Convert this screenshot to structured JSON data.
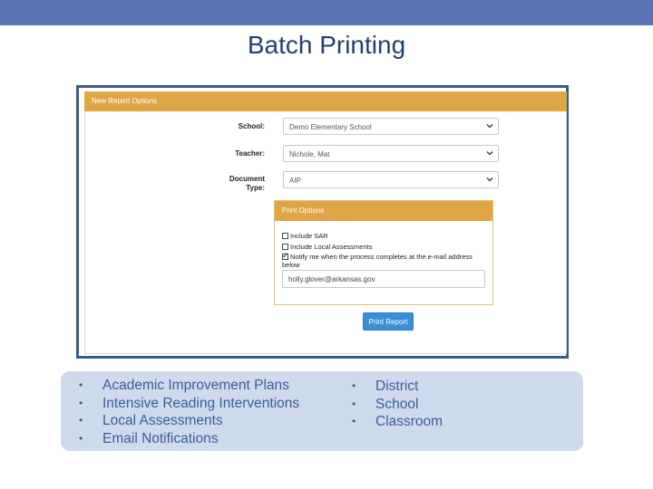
{
  "slide": {
    "title": "Batch Printing"
  },
  "panel": {
    "header": "New Report Options",
    "school_label": "School:",
    "school_value": "Demo Elementary School",
    "teacher_label": "Teacher:",
    "teacher_value": "Nichole, Mat",
    "doctype_label_1": "Document",
    "doctype_label_2": "Type:",
    "doctype_value": "AIP",
    "print_options": {
      "header": "Print Options",
      "include_sar": "Include SAR",
      "include_local": "Include Local Assessments",
      "notify_line1": "Notify me when the process completes at the e-mail address",
      "notify_line2": "below",
      "email": "holly.glover@arkansas.gov"
    },
    "print_button": "Print Report"
  },
  "bullets_left": [
    "Academic Improvement Plans",
    "Intensive Reading Interventions",
    "Local Assessments",
    "Email Notifications"
  ],
  "bullets_right": [
    "District",
    "School",
    "Classroom"
  ],
  "bullet_glyph": "•",
  "colors": {
    "band": "#5b74b4",
    "accent": "#dfa645",
    "button": "#3b8fd6",
    "bullet_bg": "#cfdaed"
  }
}
